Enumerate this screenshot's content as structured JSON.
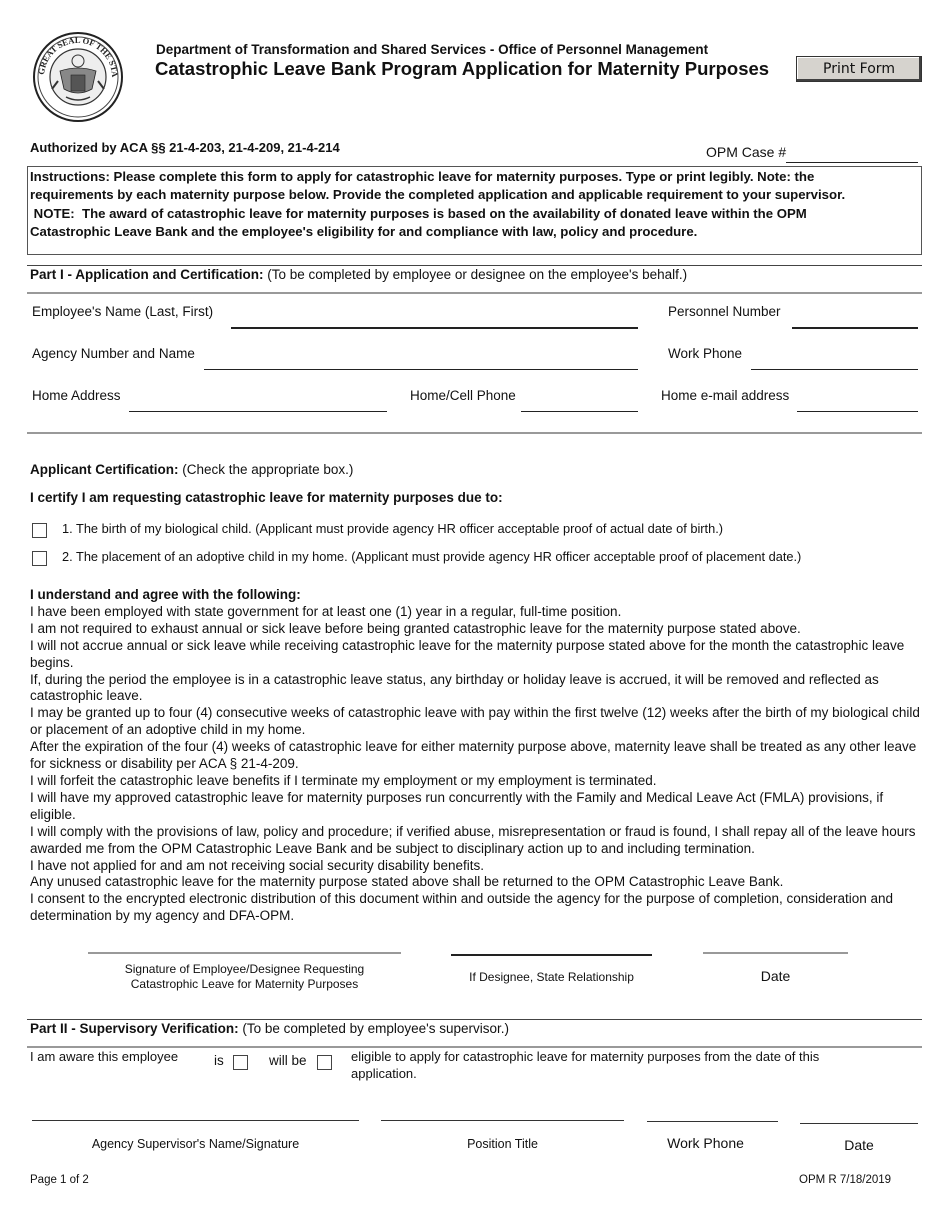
{
  "header": {
    "seal_icon": "arkansas-state-seal-icon",
    "department": "Department of Transformation and Shared Services - Office of Personnel Management",
    "title": "Catastrophic Leave Bank Program Application for Maternity Purposes",
    "print_button": "Print Form"
  },
  "authorization": "Authorized by ACA §§ 21-4-203, 21-4-209, 21-4-214",
  "opm_case": {
    "label": "OPM Case #",
    "value": ""
  },
  "instructions": {
    "line1": "Instructions:  Please complete this form to apply for catastrophic leave for maternity purposes.  Type or print legibly.  Note:  the",
    "line2": "requirements by each maternity purpose below.  Provide the completed application and applicable requirement to your supervisor.",
    "line3": " NOTE:  The award of catastrophic leave for maternity purposes is based on the availability of donated leave within the OPM",
    "line4": "Catastrophic Leave Bank and the employee's eligibility for and compliance with law, policy and procedure."
  },
  "part1": {
    "heading_bold": "Part I - Application and Certification:",
    "heading_rest": " (To be completed by employee or designee on the employee's behalf.)",
    "fields": {
      "employee_name": {
        "label": "Employee's Name (Last, First)",
        "value": ""
      },
      "personnel_number": {
        "label": "Personnel Number",
        "value": ""
      },
      "agency": {
        "label": "Agency Number and Name",
        "value": ""
      },
      "work_phone": {
        "label": "Work Phone",
        "value": ""
      },
      "home_address": {
        "label": "Home Address",
        "value": ""
      },
      "home_cell_phone": {
        "label": "Home/Cell Phone",
        "value": ""
      },
      "home_email": {
        "label": "Home e-mail address",
        "value": ""
      }
    }
  },
  "certification": {
    "heading_bold": "Applicant Certification:",
    "heading_rest": " (Check the appropriate box.)",
    "certify_text": "I certify I am requesting catastrophic leave for maternity purposes due to:",
    "options": [
      {
        "label": "1.  The birth of my biological child.  (Applicant must provide agency HR officer acceptable proof of actual date of birth.)",
        "checked": false
      },
      {
        "label": "2.  The placement of an adoptive child in my home. (Applicant must provide agency HR officer acceptable proof of placement date.)",
        "checked": false
      }
    ]
  },
  "agreement": {
    "heading": "I understand and agree with the following:",
    "items": [
      "I have been employed with state government for at least one (1) year in a regular, full-time position.",
      "I am not required to exhaust annual or sick leave before being granted catastrophic leave for the maternity purpose stated above.",
      "I will not accrue annual or sick leave while receiving catastrophic leave for the maternity purpose stated above for the month the catastrophic leave begins.",
      "If, during the period the employee is in a catastrophic leave status, any birthday or holiday leave is accrued, it will be removed and reflected as catastrophic leave.",
      "I may be granted up to four (4) consecutive weeks of catastrophic leave with pay within the first twelve (12) weeks after the birth of my biological child or placement of an adoptive child in my home.",
      "After the expiration of the four (4) weeks of catastrophic leave for either maternity purpose above, maternity leave shall be treated as any other leave for sickness or disability per ACA § 21-4-209.",
      "I will forfeit the catastrophic leave benefits if I terminate my employment or my employment is terminated.",
      "I will have my approved catastrophic leave for maternity purposes run concurrently with the Family and Medical Leave Act (FMLA) provisions, if eligible.",
      "I will comply with the provisions of law, policy and procedure; if verified abuse, misrepresentation or fraud is found, I shall repay all of the leave hours awarded me from the OPM Catastrophic Leave Bank and be subject to disciplinary action up to and including termination.",
      "I have not applied for and am not receiving social security disability benefits.",
      "Any unused catastrophic leave for the maternity purpose stated above shall be returned to the OPM Catastrophic Leave Bank.",
      "I consent to the encrypted electronic distribution of this document within and outside the agency for the purpose of completion, consideration and determination by my agency and DFA-OPM."
    ]
  },
  "employee_signature": {
    "signature_label_line1": "Signature of Employee/Designee Requesting",
    "signature_label_line2": "Catastrophic Leave for Maternity Purposes",
    "relationship_label": "If Designee, State Relationship",
    "date_label": "Date"
  },
  "part2": {
    "heading_bold": "Part II - Supervisory Verification:",
    "heading_rest": " (To be completed by employee's supervisor.)",
    "aware_text": "I am aware this employee",
    "is_label": "is",
    "is_checked": false,
    "will_be_label": "will be",
    "will_be_checked": false,
    "eligible_line1": "eligible to apply for catastrophic leave for maternity purposes from the date of this",
    "eligible_line2": "application."
  },
  "supervisor_signature": {
    "name_label": "Agency Supervisor's Name/Signature",
    "position_label": "Position Title",
    "work_phone_label": "Work Phone",
    "date_label": "Date"
  },
  "footer": {
    "page": "Page 1 of 2",
    "form_id": "OPM R 7/18/2019"
  }
}
